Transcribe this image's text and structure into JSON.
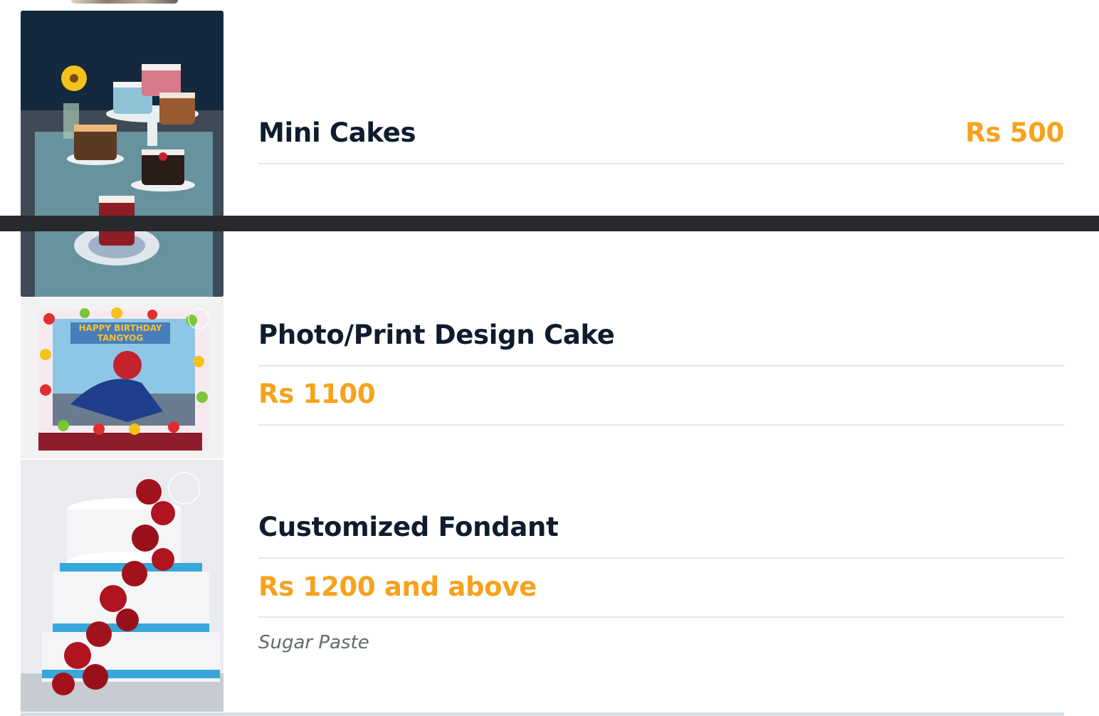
{
  "menu_items": [
    {
      "name": "Mini Cakes",
      "price": "Rs 500",
      "image": "mini-cakes-photo"
    },
    {
      "name": "Photo/Print Design Cake",
      "price": "Rs 1100",
      "image": "photo-print-cake-photo",
      "image_text": "HAPPY BIRTHDAY TANGYOG"
    },
    {
      "name": "Customized Fondant",
      "price": "Rs 1200 and above",
      "note": "Sugar Paste",
      "image": "fondant-cake-photo"
    }
  ],
  "colors": {
    "title": "#0f1c2e",
    "price": "#f6a21d",
    "rule": "#e4e7ea",
    "bar": "#28292c"
  }
}
